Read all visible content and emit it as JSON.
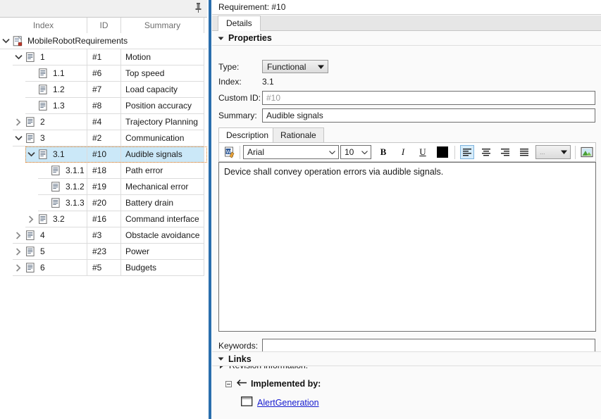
{
  "left_panel": {
    "pin_icon": "pin-icon",
    "columns": [
      "Index",
      "ID",
      "Summary"
    ],
    "rows": [
      {
        "index": "MobileRobotRequirements",
        "id": "",
        "summary": "",
        "depth": 0,
        "expander": "expanded",
        "icon": "requirement-set-icon",
        "selected": false,
        "root": true
      },
      {
        "index": "1",
        "id": "#1",
        "summary": "Motion",
        "depth": 1,
        "expander": "expanded",
        "icon": "requirement-icon",
        "selected": false
      },
      {
        "index": "1.1",
        "id": "#6",
        "summary": "Top speed",
        "depth": 2,
        "expander": "none",
        "icon": "requirement-icon",
        "selected": false
      },
      {
        "index": "1.2",
        "id": "#7",
        "summary": "Load capacity",
        "depth": 2,
        "expander": "none",
        "icon": "requirement-icon",
        "selected": false
      },
      {
        "index": "1.3",
        "id": "#8",
        "summary": "Position accuracy",
        "depth": 2,
        "expander": "none",
        "icon": "requirement-icon",
        "selected": false
      },
      {
        "index": "2",
        "id": "#4",
        "summary": "Trajectory Planning",
        "depth": 1,
        "expander": "collapsed",
        "icon": "requirement-icon",
        "selected": false
      },
      {
        "index": "3",
        "id": "#2",
        "summary": "Communication",
        "depth": 1,
        "expander": "expanded",
        "icon": "requirement-icon",
        "selected": false
      },
      {
        "index": "3.1",
        "id": "#10",
        "summary": "Audible signals",
        "depth": 2,
        "expander": "expanded",
        "icon": "requirement-icon",
        "selected": true
      },
      {
        "index": "3.1.1",
        "id": "#18",
        "summary": "Path error",
        "depth": 3,
        "expander": "none",
        "icon": "requirement-icon",
        "selected": false
      },
      {
        "index": "3.1.2",
        "id": "#19",
        "summary": "Mechanical error",
        "depth": 3,
        "expander": "none",
        "icon": "requirement-icon",
        "selected": false
      },
      {
        "index": "3.1.3",
        "id": "#20",
        "summary": "Battery drain",
        "depth": 3,
        "expander": "none",
        "icon": "requirement-icon",
        "selected": false
      },
      {
        "index": "3.2",
        "id": "#16",
        "summary": "Command interface",
        "depth": 2,
        "expander": "collapsed",
        "icon": "requirement-icon",
        "selected": false
      },
      {
        "index": "4",
        "id": "#3",
        "summary": "Obstacle avoidance",
        "depth": 1,
        "expander": "collapsed",
        "icon": "requirement-icon",
        "selected": false
      },
      {
        "index": "5",
        "id": "#23",
        "summary": "Power",
        "depth": 1,
        "expander": "collapsed",
        "icon": "requirement-icon",
        "selected": false
      },
      {
        "index": "6",
        "id": "#5",
        "summary": "Budgets",
        "depth": 1,
        "expander": "collapsed",
        "icon": "requirement-icon",
        "selected": false
      }
    ]
  },
  "right_panel": {
    "requirement_title": "Requirement: #10",
    "tabs": [
      {
        "label": "Details",
        "active": true
      }
    ],
    "properties": {
      "section_label": "Properties",
      "expanded": true,
      "type_label": "Type:",
      "type_value": "Functional",
      "index_label": "Index:",
      "index_value": "3.1",
      "custom_id_label": "Custom ID:",
      "custom_id_value": "#10",
      "custom_id_is_placeholder": true,
      "summary_label": "Summary:",
      "summary_value": "Audible signals"
    },
    "description_tabs": [
      {
        "label": "Description",
        "active": true
      },
      {
        "label": "Rationale",
        "active": false
      }
    ],
    "editor_toolbar": {
      "open_in_word_icon": "word-edit-icon",
      "font_family": "Arial",
      "font_size": "10",
      "bold_label": "B",
      "italic_label": "I",
      "underline_label": "U",
      "text_color": "#000000",
      "align_left_icon": "align-left-icon",
      "align_center_icon": "align-center-icon",
      "align_right_icon": "align-right-icon",
      "align_justify_icon": "align-justify-icon",
      "style_value": "...",
      "insert_image_icon": "insert-image-icon"
    },
    "description_text": "Device shall convey operation errors via audible signals.",
    "keywords_label": "Keywords:",
    "keywords_value": "",
    "revision_label": "Revision information:",
    "revision_expanded": false,
    "links": {
      "section_label": "Links",
      "expanded": true,
      "group_label": "Implemented by:",
      "group_icon": "left-arrow-icon",
      "items": [
        {
          "name": "AlertGeneration",
          "icon": "block-icon"
        }
      ]
    }
  },
  "colors": {
    "splitter": "#2a6ead",
    "selection_fill": "#cbe8f8",
    "selection_outline": "#e07b1e",
    "link_text": "#1419cf",
    "header_text": "#6e6e6e"
  }
}
